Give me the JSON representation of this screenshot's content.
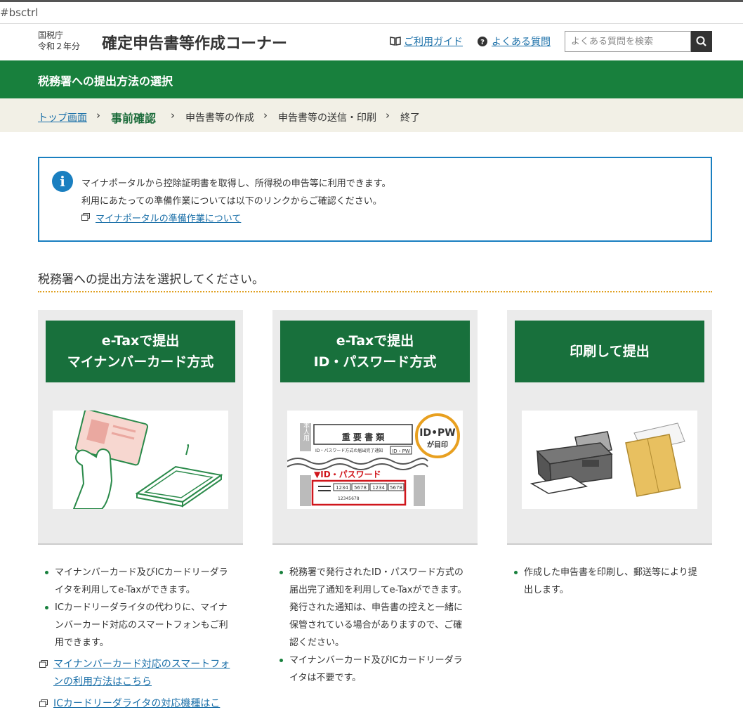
{
  "browser": {
    "address": "#bsctrl"
  },
  "header": {
    "agency": "国税庁",
    "year": "令和２年分",
    "title": "確定申告書等作成コーナー",
    "guide_link": "ご利用ガイド",
    "faq_link": "よくある質問",
    "search_placeholder": "よくある質問を検索"
  },
  "page_heading": "税務署への提出方法の選択",
  "breadcrumb": {
    "top": "トップ画面",
    "current": "事前確認",
    "step2": "申告書等の作成",
    "step3": "申告書等の送信・印刷",
    "step4": "終了",
    "separator": "›"
  },
  "info": {
    "line1": "マイナポータルから控除証明書を取得し、所得税の申告等に利用できます。",
    "line2": "利用にあたっての準備作業については以下のリンクからご確認ください。",
    "link": "マイナポータルの準備作業について"
  },
  "prompt": "税務署への提出方法を選択してください。",
  "options": [
    {
      "line1": "e-Taxで提出",
      "line2": "マイナンバーカード方式"
    },
    {
      "line1": "e-Taxで提出",
      "line2": "ID・パスワード方式"
    },
    {
      "line1": "印刷して提出",
      "line2": ""
    }
  ],
  "illustration_text": {
    "important_docs": "重 要 書 類",
    "notice_title": "ID・パスワード方式の届出完了通知",
    "badge_small": "ID・PW",
    "id_password": "▼ID・パスワード",
    "badge_line1": "ID•PW",
    "badge_line2": "が目印",
    "honnin": "本人用",
    "n1": "1234",
    "n2": "5678",
    "n3": "1234",
    "n4": "5678",
    "small_num": "12345678"
  },
  "descriptions": {
    "card1": {
      "items": [
        "マイナンバーカード及びICカードリーダライタを利用してe-Taxができます。",
        "ICカードリーダライタの代わりに、マイナンバーカード対応のスマートフォンもご利用できます。"
      ],
      "links": [
        "マイナンバーカード対応のスマートフォンの利用方法はこちら",
        "ICカードリーダライタの対応機種はこ"
      ]
    },
    "card2": {
      "item1": "税務署で発行されたID・パスワード方式の届出完了通知を利用してe-Taxができます。",
      "item1_extra": "発行された通知は、申告書の控えと一緒に保管されている場合がありますので、ご確認ください。",
      "item2": "マイナンバーカード及びICカードリーダライタは不要です。"
    },
    "card3": {
      "item1": "作成した申告書を印刷し、郵送等により提出します。"
    }
  }
}
